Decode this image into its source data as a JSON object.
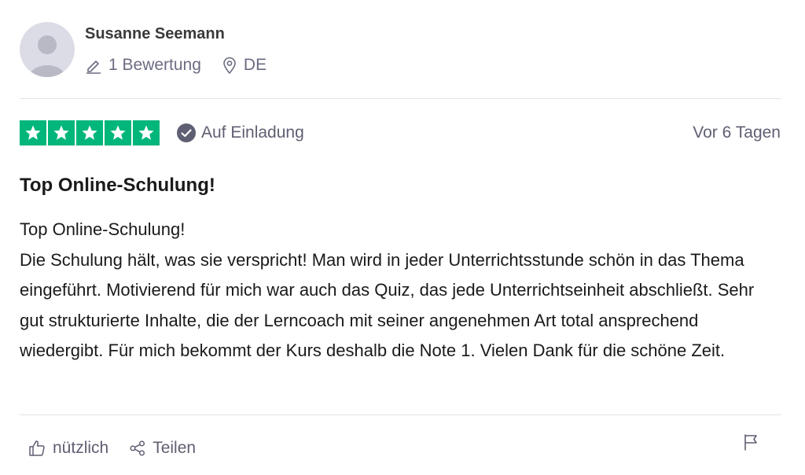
{
  "reviewer": {
    "name": "Susanne Seemann",
    "review_count": "1 Bewertung",
    "country": "DE",
    "avatar_icon": "default-avatar-icon"
  },
  "rating": {
    "stars": 5,
    "star_color": "#00b67a",
    "badge": "Auf Einladung",
    "date": "Vor 6 Tagen"
  },
  "review": {
    "title": "Top Online-Schulung!",
    "body_lines": [
      "Top Online-Schulung!",
      "Die Schulung hält, was sie verspricht! Man wird in jeder Unterrichtsstunde schön in das Thema eingeführt. Motivierend für mich war auch das Quiz, das jede Unterrichtseinheit abschließt. Sehr gut strukturierte Inhalte, die der Lerncoach mit seiner angenehmen Art total ansprechend wiedergibt. Für mich bekommt der Kurs deshalb die Note 1. Vielen Dank für die schöne Zeit."
    ]
  },
  "actions": {
    "useful": "nützlich",
    "share": "Teilen",
    "useful_icon": "thumbs-up-icon",
    "share_icon": "share-icon",
    "flag_icon": "flag-icon"
  }
}
